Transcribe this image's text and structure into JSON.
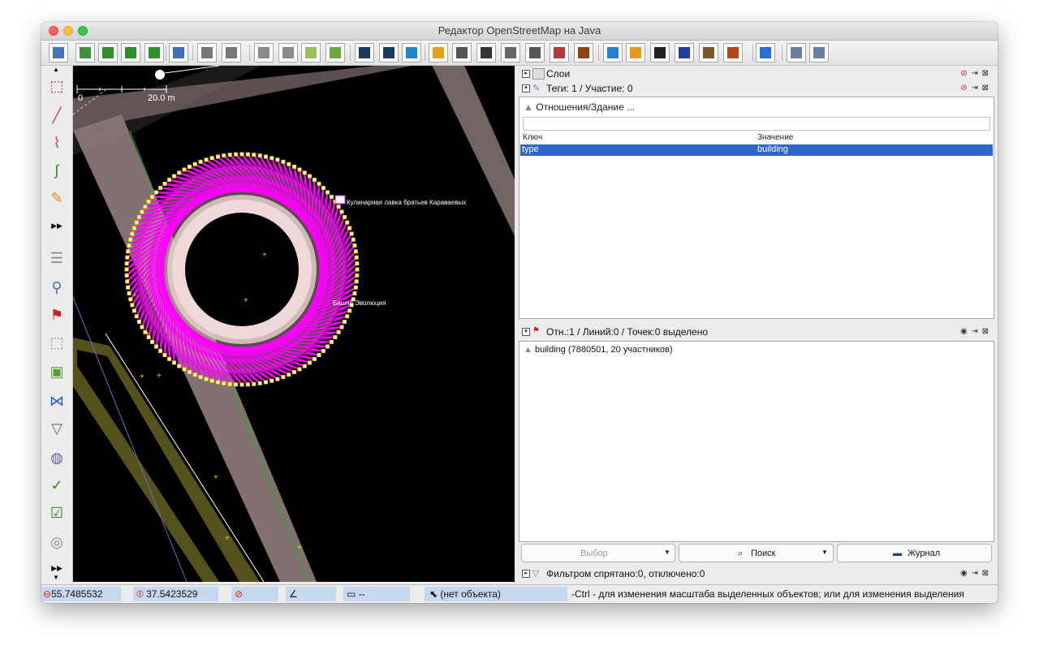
{
  "window": {
    "title": "Редактор OpenStreetMap на Java"
  },
  "toolbar": {
    "buttons": [
      {
        "name": "open-file-icon",
        "color": "#4a73b5"
      },
      {
        "name": "open-location-icon",
        "color": "#3c8f3c"
      },
      {
        "name": "download-icon",
        "color": "#2f8f2f"
      },
      {
        "name": "download-notes-icon",
        "color": "#2f8f2f"
      },
      {
        "name": "upload-icon",
        "color": "#2f8f2f"
      },
      {
        "name": "search-web-icon",
        "color": "#3f6fb7"
      },
      {
        "name": "undo-icon",
        "color": "#777777"
      },
      {
        "name": "redo-icon",
        "color": "#777777"
      },
      {
        "name": "imagery-1-icon",
        "color": "#8a8a8a"
      },
      {
        "name": "imagery-2-icon",
        "color": "#8a8a8a"
      },
      {
        "name": "wms-icon",
        "color": "#9bbf5a"
      },
      {
        "name": "zoom-imagery-icon",
        "color": "#6aa83c"
      },
      {
        "name": "road-1-icon",
        "color": "#1a3a5a"
      },
      {
        "name": "road-2-icon",
        "color": "#1a3a5a"
      },
      {
        "name": "bing-icon",
        "color": "#1e88c8"
      },
      {
        "name": "traffic-light-icon",
        "color": "#e3a21a"
      },
      {
        "name": "railway-1-icon",
        "color": "#555555"
      },
      {
        "name": "railway-2-icon",
        "color": "#333333"
      },
      {
        "name": "barrier-icon",
        "color": "#666666"
      },
      {
        "name": "signal-icon",
        "color": "#555555"
      },
      {
        "name": "wall-icon",
        "color": "#b33a3a"
      },
      {
        "name": "fence-icon",
        "color": "#8b4513"
      },
      {
        "name": "bed-icon",
        "color": "#2a7fd5"
      },
      {
        "name": "shop-icon",
        "color": "#e89a1f"
      },
      {
        "name": "football-icon",
        "color": "#222222"
      },
      {
        "name": "info-icon",
        "color": "#1f3fa0"
      },
      {
        "name": "factory-icon",
        "color": "#7a5a2a"
      },
      {
        "name": "mountain-icon",
        "color": "#b5471b"
      },
      {
        "name": "waterway-icon",
        "color": "#2a6fd5"
      },
      {
        "name": "zoom-in-icon",
        "color": "#6a7fa0"
      },
      {
        "name": "zoom-out-icon",
        "color": "#6a7fa0"
      }
    ]
  },
  "left_tools": [
    {
      "name": "select-tool-icon"
    },
    {
      "name": "draw-line-tool-icon"
    },
    {
      "name": "improve-way-tool-icon"
    },
    {
      "name": "parallel-tool-icon"
    },
    {
      "name": "draw-tool-icon"
    },
    {
      "name": "more-tools-icon"
    },
    {
      "name": "layers-toggle-icon"
    },
    {
      "name": "tags-toggle-icon"
    },
    {
      "name": "relation-toggle-icon"
    },
    {
      "name": "selection-toggle-icon"
    },
    {
      "name": "imagery-toggle-icon"
    },
    {
      "name": "conflict-toggle-icon"
    },
    {
      "name": "filter-toggle-icon"
    },
    {
      "name": "map-paint-toggle-icon"
    },
    {
      "name": "validator-toggle-icon"
    },
    {
      "name": "todo-toggle-icon"
    },
    {
      "name": "wiki-toggle-icon"
    },
    {
      "name": "more-toggles-icon"
    }
  ],
  "map": {
    "scale_start": "0",
    "scale_end": "20.0 m",
    "labels": {
      "shop": "Кулинарная лавка братьев Караваевых",
      "tower": "Башня Эволюция"
    },
    "colors": {
      "selection": "#ff00ff",
      "node": "#ffd000",
      "building_fill": "#c8a8a8"
    }
  },
  "panels": {
    "layers": {
      "title": "Слои"
    },
    "tags": {
      "title": "Теги: 1 / Участие: 0",
      "relation_header": "Отношения/Здание ...",
      "col_key": "Ключ",
      "col_value": "Значение",
      "rows": [
        {
          "key": "type",
          "value": "building"
        }
      ]
    },
    "selection": {
      "title": "Отн.:1 / Линий:0 / Точек:0 выделено",
      "items": [
        "building (7880501, 20 участников)"
      ]
    },
    "buttons": {
      "select": "Выбор",
      "search": "Поиск",
      "history": "Журнал"
    },
    "filter": {
      "title": "Фильтром спрятано:0, отключено:0"
    }
  },
  "status": {
    "lat": "55.7485532",
    "lon": "37.5423529",
    "heading": "",
    "angle": "",
    "length": "--",
    "object": "(нет объекта)",
    "help": "-Ctrl - для изменения масштаба выделенных объектов; или для изменения выделения"
  }
}
